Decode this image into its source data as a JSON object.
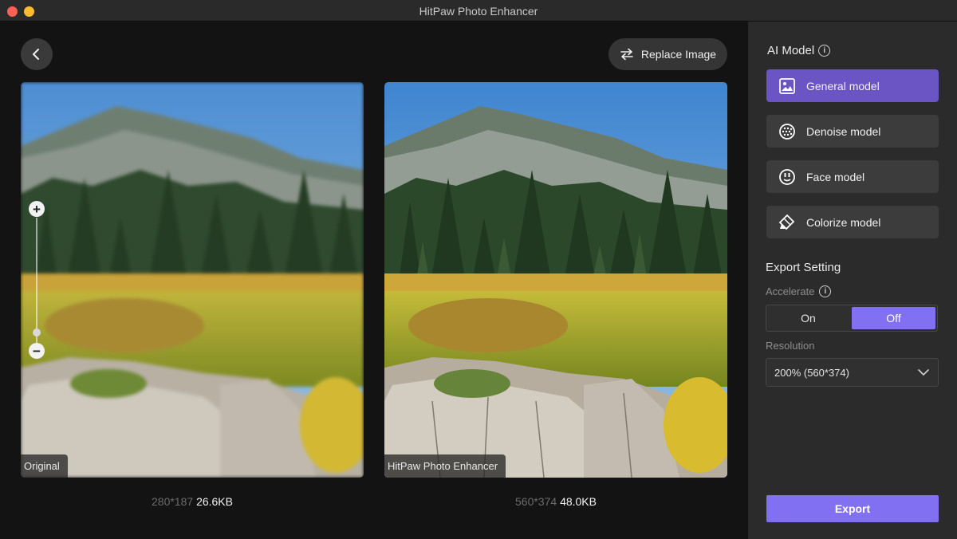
{
  "window": {
    "title": "HitPaw Photo Enhancer"
  },
  "toolbar": {
    "back_icon": "chevron-left-icon",
    "replace_label": "Replace Image",
    "replace_icon": "swap-arrows-icon"
  },
  "preview": {
    "original": {
      "label": "Original",
      "dimensions": "280*187",
      "file_size": "26.6KB"
    },
    "enhanced": {
      "label": "HitPaw Photo Enhancer",
      "dimensions": "560*374",
      "file_size": "48.0KB"
    },
    "zoom": {
      "plus": "+",
      "minus": "−"
    }
  },
  "sidebar": {
    "ai_model_title": "AI Model",
    "models": [
      {
        "label": "General model",
        "icon": "image-icon",
        "active": true
      },
      {
        "label": "Denoise model",
        "icon": "grid-circle-icon",
        "active": false
      },
      {
        "label": "Face model",
        "icon": "face-icon",
        "active": false
      },
      {
        "label": "Colorize model",
        "icon": "paint-bucket-icon",
        "active": false
      }
    ],
    "export_title": "Export Setting",
    "accelerate_label": "Accelerate",
    "accelerate_on": "On",
    "accelerate_off": "Off",
    "accelerate_selected": "Off",
    "resolution_label": "Resolution",
    "resolution_value": "200% (560*374)",
    "export_button": "Export"
  },
  "colors": {
    "accent": "#8170f2",
    "active_model": "#6b55c4",
    "sidebar_bg": "#2b2b2b",
    "main_bg": "#131313"
  }
}
